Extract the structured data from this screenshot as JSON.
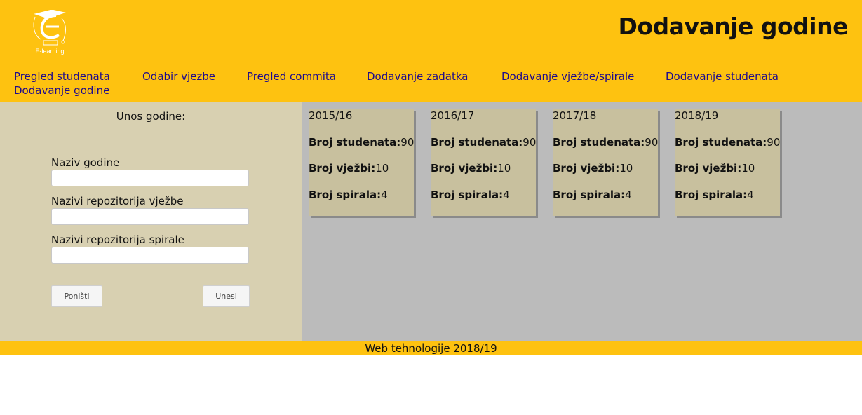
{
  "header": {
    "logo_text": "E-learning",
    "title": "Dodavanje godine",
    "nav": [
      {
        "label": "Pregled studenata"
      },
      {
        "label": "Odabir vjezbe"
      },
      {
        "label": "Pregled commita"
      },
      {
        "label": "Dodavanje zadatka"
      },
      {
        "label": "Dodavanje vježbe/spirale"
      },
      {
        "label": "Dodavanje studenata"
      },
      {
        "label": "Dodavanje godine"
      }
    ]
  },
  "form": {
    "title": "Unos godine:",
    "fields": [
      {
        "label": "Naziv godine",
        "value": ""
      },
      {
        "label": "Nazivi repozitorija vježbe",
        "value": ""
      },
      {
        "label": "Nazivi repozitorija spirale",
        "value": ""
      }
    ],
    "reset_label": "Poništi",
    "submit_label": "Unesi"
  },
  "labels": {
    "students": "Broj studenata:",
    "exercises": "Broj vježbi:",
    "spirals": "Broj spirala:"
  },
  "years": [
    {
      "name": "2015/16",
      "students": "90",
      "exercises": "10",
      "spirals": "4"
    },
    {
      "name": "2016/17",
      "students": "90",
      "exercises": "10",
      "spirals": "4"
    },
    {
      "name": "2017/18",
      "students": "90",
      "exercises": "10",
      "spirals": "4"
    },
    {
      "name": "2018/19",
      "students": "90",
      "exercises": "10",
      "spirals": "4"
    }
  ],
  "footer": {
    "text": "Web tehnologije 2018/19"
  }
}
